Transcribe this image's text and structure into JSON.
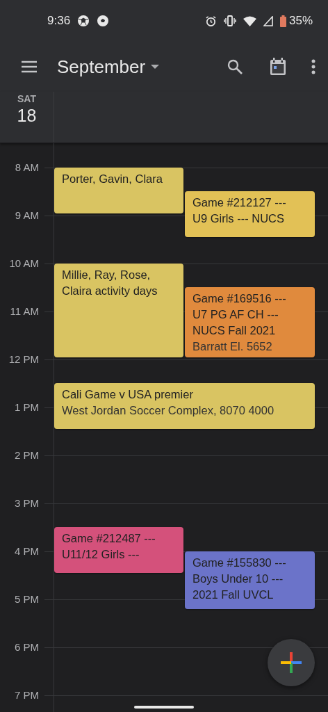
{
  "status_bar": {
    "time": "9:36",
    "battery": "35%"
  },
  "toolbar": {
    "title": "September"
  },
  "day": {
    "weekday": "SAT",
    "date": "18"
  },
  "hours": [
    "8 AM",
    "9 AM",
    "10 AM",
    "11 AM",
    "12 PM",
    "1 PM",
    "2 PM",
    "3 PM",
    "4 PM",
    "5 PM",
    "6 PM",
    "7 PM"
  ],
  "events": [
    {
      "title": "Porter, Gavin, Clara",
      "color": "#d9c462"
    },
    {
      "title": "Game #212127 --- U9 Girls --- NUCS",
      "color": "#e2c156"
    },
    {
      "title": "Millie, Ray, Rose, Claira activity days",
      "color": "#d9c462"
    },
    {
      "title": "Game #169516 --- U7 PG AF CH --- NUCS Fall 2021",
      "location": "Barratt El. 5652",
      "color": "#e08a3d"
    },
    {
      "title": "Cali Game v USA premier",
      "location": "West Jordan Soccer Complex, 8070 4000",
      "color": "#d9c462"
    },
    {
      "title": "Game #212487 --- U11/12 Girls ---",
      "color": "#d4517b"
    },
    {
      "title": "Game #155830 --- Boys Under 10 --- 2021 Fall UVCL",
      "color": "#6b73c9"
    }
  ]
}
